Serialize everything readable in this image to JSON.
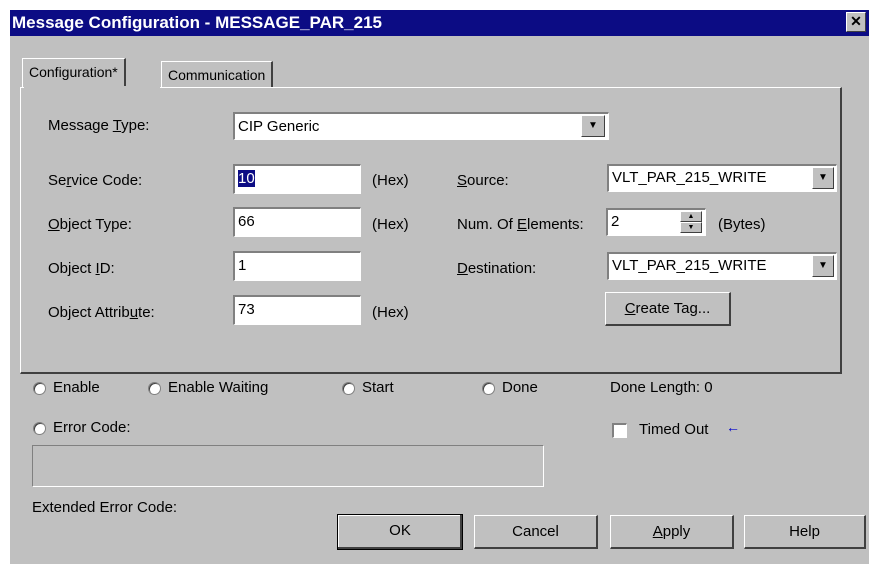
{
  "window": {
    "title": "Message Configuration - MESSAGE_PAR_215",
    "close_glyph": "✕"
  },
  "tabs": [
    {
      "label": "Configuration*",
      "active": true
    },
    {
      "label": "Communication",
      "active": false
    }
  ],
  "config": {
    "message_type": {
      "label_pre": "Message ",
      "label_key": "T",
      "label_post": "ype:",
      "value": "CIP Generic"
    },
    "service_code": {
      "label_pre": "Se",
      "label_key": "r",
      "label_post": "vice Code:",
      "value": "10",
      "unit": "(Hex)"
    },
    "object_type": {
      "label_pre": "",
      "label_key": "O",
      "label_post": "bject Type:",
      "value": "66",
      "unit": "(Hex)"
    },
    "object_id": {
      "label_pre": "Object ",
      "label_key": "I",
      "label_post": "D:",
      "value": "1"
    },
    "object_attribute": {
      "label_pre": "Object Attrib",
      "label_key": "u",
      "label_post": "te:",
      "value": "73",
      "unit": "(Hex)"
    },
    "source": {
      "label_pre": "",
      "label_key": "S",
      "label_post": "ource:",
      "value": "VLT_PAR_215_WRITE"
    },
    "num_elements": {
      "label_pre": "Num. Of ",
      "label_key": "E",
      "label_post": "lements:",
      "value": "2",
      "unit": "(Bytes)"
    },
    "destination": {
      "label_pre": "",
      "label_key": "D",
      "label_post": "estination:",
      "value": "VLT_PAR_215_WRITE"
    },
    "create_tag": {
      "label_pre": "",
      "label_key": "C",
      "label_post": "reate Tag..."
    }
  },
  "status": {
    "enable": "Enable",
    "enable_waiting": "Enable Waiting",
    "start": "Start",
    "done": "Done",
    "done_length_label": "Done Length:",
    "done_length_value": "0",
    "error_code": "Error Code:",
    "timed_out": "Timed Out",
    "timed_out_arrow": "←",
    "extended_error_code": "Extended Error Code:"
  },
  "buttons": {
    "ok": "OK",
    "cancel": "Cancel",
    "apply_key": "A",
    "apply_rest": "pply",
    "help": "Help"
  },
  "colors": {
    "titlebar": "#0c0c84",
    "face": "#c0c0c0",
    "arrow": "#0000cc"
  }
}
